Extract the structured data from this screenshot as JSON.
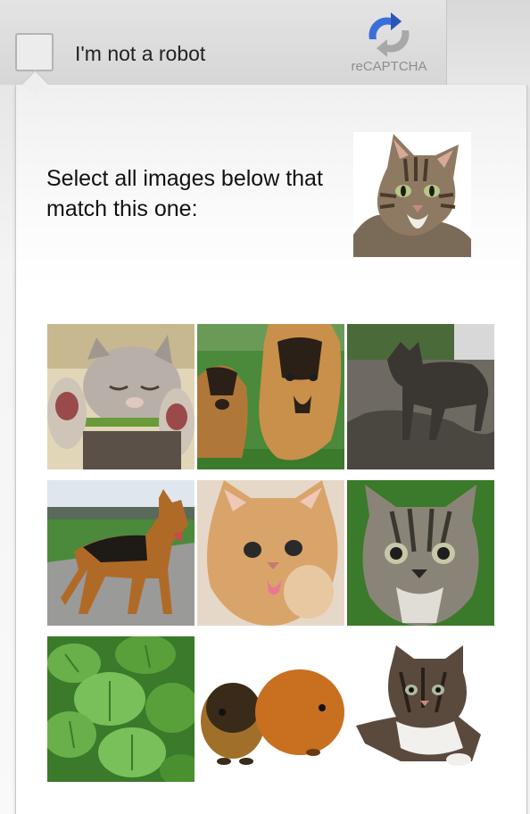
{
  "widget": {
    "checkbox_label": "I'm not a robot",
    "logo_text": "reCAPTCHA",
    "logo_icon": "recaptcha-arrows-icon"
  },
  "challenge": {
    "instruction": "Select all images below that match this one:",
    "reference_image": "tabby-cat-head",
    "tiles": [
      {
        "subject": "sleeping-kitten-paws"
      },
      {
        "subject": "german-shepherd-puppies"
      },
      {
        "subject": "dark-dog-outdoors"
      },
      {
        "subject": "german-shepherd-standing"
      },
      {
        "subject": "ginger-kitten"
      },
      {
        "subject": "tabby-kitten-green-background"
      },
      {
        "subject": "green-plant-leaves"
      },
      {
        "subject": "two-guinea-pigs"
      },
      {
        "subject": "calico-kitten-lying"
      }
    ]
  },
  "colors": {
    "logo_blue": "#3b6fd8",
    "logo_gray": "#a8a8a8",
    "border": "#c8c8c8"
  }
}
